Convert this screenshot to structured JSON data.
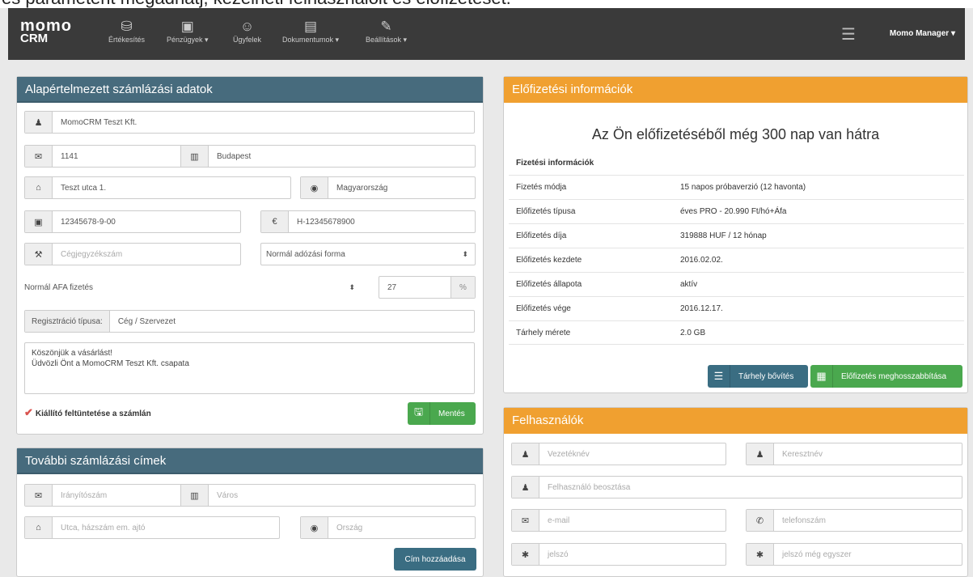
{
  "caption": "és paraméterit megadhatj, kezelheti felhasználóit és előfizetését.",
  "nav": {
    "logo_line1": "momo",
    "logo_line2": "CRM",
    "items": [
      {
        "label": "Értékesítés",
        "icon": "coins-icon"
      },
      {
        "label": "Pénzügyek ▾",
        "icon": "money-icon"
      },
      {
        "label": "Ügyfelek",
        "icon": "user-icon"
      },
      {
        "label": "Dokumentumok ▾",
        "icon": "document-icon"
      },
      {
        "label": "Beállítások ▾",
        "icon": "wrench-icon"
      }
    ],
    "menu_icon": "list-icon",
    "user": "Momo Manager ▾"
  },
  "billing": {
    "title": "Alapértelmezett számlázási adatok",
    "company": "MomoCRM Teszt Kft.",
    "zip": "1141",
    "city": "Budapest",
    "street": "Teszt utca 1.",
    "country": "Magyarország",
    "tax_id": "12345678-9-00",
    "eu_tax": "H-12345678900",
    "reg_placeholder": "Cégjegyzékszám",
    "tax_form": "Normál adózási forma",
    "vat_mode": "Normál ÁFA fizetés",
    "vat_rate": "27",
    "vat_unit": "%",
    "reg_type_label": "Regisztráció típusa:",
    "reg_type": "Cég / Szervezet",
    "note_line1": "Köszönjük a vásárlást!",
    "note_line2": "Üdvözli Önt a MomoCRM Teszt Kft. csapata",
    "show_issuer": "Kiállító feltüntetése a számlán",
    "save": "Mentés"
  },
  "addresses": {
    "title": "További számlázási címek",
    "zip_ph": "Irányítószám",
    "city_ph": "Város",
    "street_ph": "Utca, házszám em. ajtó",
    "country_ph": "Ország",
    "add": "Cím hozzáadása"
  },
  "subscription": {
    "title": "Előfizetési információk",
    "remaining": "Az Ön előfizetéséből még 300 nap van hátra",
    "section": "Fizetési információk",
    "rows": [
      {
        "k": "Fizetés módja",
        "v": "15 napos próbaverzió (12 havonta)"
      },
      {
        "k": "Előfizetés típusa",
        "v": "éves PRO - 20.990 Ft/hó+Áfa"
      },
      {
        "k": "Előfizetés díja",
        "v": "319888 HUF / 12 hónap"
      },
      {
        "k": "Előfizetés kezdete",
        "v": "2016.02.02."
      },
      {
        "k": "Előfizetés állapota",
        "v": "aktív"
      },
      {
        "k": "Előfizetés vége",
        "v": "2016.12.17."
      },
      {
        "k": "Tárhely mérete",
        "v": "2.0 GB"
      }
    ],
    "storage_btn": "Tárhely bővítés",
    "extend_btn": "Előfizetés meghosszabbítása"
  },
  "users": {
    "title": "Felhasználók",
    "lastname_ph": "Vezetéknév",
    "firstname_ph": "Keresztnév",
    "position_ph": "Felhasználó beosztása",
    "email_ph": "e-mail",
    "phone_ph": "telefonszám",
    "password_ph": "jelszó",
    "password2_ph": "jelszó még egyszer"
  }
}
